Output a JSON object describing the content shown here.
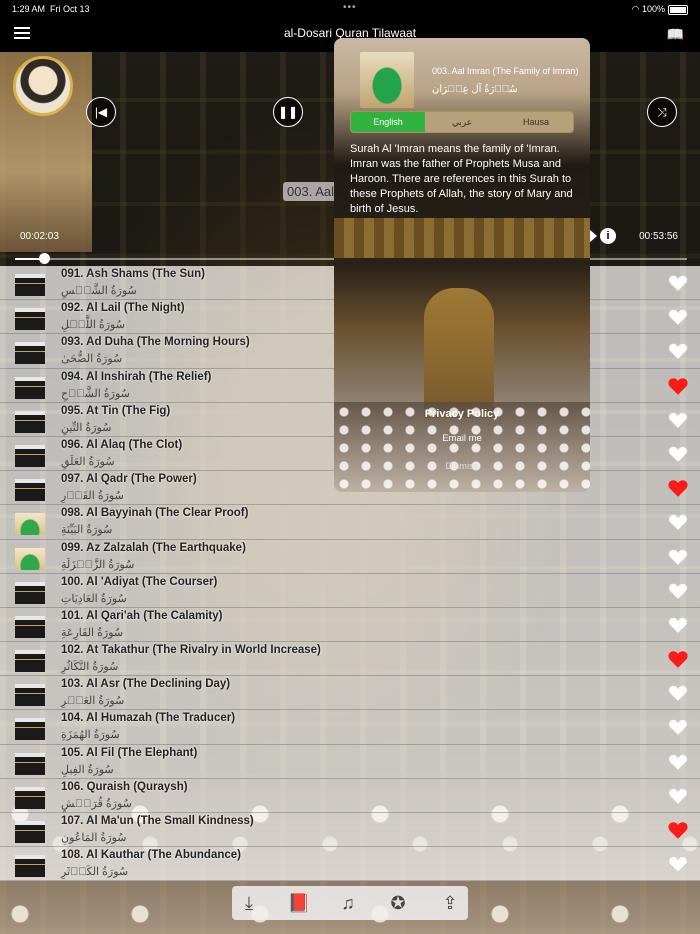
{
  "status": {
    "time": "1:29 AM",
    "date": "Fri Oct 13",
    "dots": "•••",
    "battery": "100%"
  },
  "header": {
    "title": "al-Dosari Quran Tilawaat"
  },
  "player": {
    "track_chip": "003. Aal",
    "elapsed": "00:02:03",
    "duration": "00:53:56",
    "progress": 0.043
  },
  "popup": {
    "title": "003. Aal Imran (The Family of Imran)",
    "arabic": "سُوۡرَةُ آل عِمۡرَان",
    "tabs": [
      {
        "label": "English"
      },
      {
        "label": "عربي"
      },
      {
        "label": "Hausa"
      }
    ],
    "active_tab": 0,
    "description": "Surah Al 'Imran means the family of 'Imran. Imran was the father of Prophets Musa and Haroon. There are references in this Surah to these Prophets of Allah, the story of Mary and birth of Jesus.",
    "privacy": "Privacy Policy",
    "email": "Email me",
    "dismiss": "Dismiss"
  },
  "surahs": [
    {
      "en": "091. Ash Shams (The Sun)",
      "ar": "سُورَةُ الشَّمۡسِ",
      "thumb": "kaaba",
      "fav": false
    },
    {
      "en": "092. Al Lail (The Night)",
      "ar": "سُورَةُ اللَّيۡلِ",
      "thumb": "kaaba",
      "fav": false
    },
    {
      "en": "093. Ad Duha (The Morning Hours)",
      "ar": "سُورَةُ الضُّحَىٰ",
      "thumb": "kaaba",
      "fav": false
    },
    {
      "en": "094. Al Inshirah (The Relief)",
      "ar": "سُورَةُ الشَّرۡحِ",
      "thumb": "kaaba",
      "fav": true
    },
    {
      "en": "095. At Tin (The Fig)",
      "ar": "سُورَةُ التِّينِ",
      "thumb": "kaaba",
      "fav": false
    },
    {
      "en": "096. Al Alaq (The Clot)",
      "ar": "سُورَةُ العَلَقِ",
      "thumb": "kaaba",
      "fav": false
    },
    {
      "en": "097. Al Qadr (The Power)",
      "ar": "سُورَةُ القَدۡرِ",
      "thumb": "kaaba",
      "fav": true
    },
    {
      "en": "098. Al Bayyinah (The Clear Proof)",
      "ar": "سُورَةُ البَيِّنَةِ",
      "thumb": "dome",
      "fav": false
    },
    {
      "en": "099. Az Zalzalah (The Earthquake)",
      "ar": "سُورَةُ الزَّلۡزَلَةِ",
      "thumb": "dome",
      "fav": false
    },
    {
      "en": "100. Al 'Adiyat (The Courser)",
      "ar": "سُورَةُ العَادِيَاتِ",
      "thumb": "kaaba",
      "fav": false
    },
    {
      "en": "101. Al Qari'ah (The Calamity)",
      "ar": "سُورَةُ القَارِعَةِ",
      "thumb": "kaaba",
      "fav": false
    },
    {
      "en": "102. At Takathur (The Rivalry in World Increase)",
      "ar": "سُورَةُ التَّكَاثُرِ",
      "thumb": "kaaba",
      "fav": true
    },
    {
      "en": "103. Al Asr (The Declining Day)",
      "ar": "سُورَةُ العَصۡرِ",
      "thumb": "kaaba",
      "fav": false
    },
    {
      "en": "104. Al Humazah (The Traducer)",
      "ar": "سُورَةُ الهُمَزَةِ",
      "thumb": "kaaba",
      "fav": false
    },
    {
      "en": "105. Al Fil (The Elephant)",
      "ar": "سُورَةُ الفِيلِ",
      "thumb": "kaaba",
      "fav": false
    },
    {
      "en": "106. Quraish (Quraysh)",
      "ar": "سُورَةُ قُرَيۡشٍ",
      "thumb": "kaaba",
      "fav": false
    },
    {
      "en": "107. Al Ma'un (The Small Kindness)",
      "ar": "سُورَةُ المَاعُونِ",
      "thumb": "kaaba",
      "fav": true
    },
    {
      "en": "108. Al Kauthar (The Abundance)",
      "ar": "سُورَةُ الكَوۡثَرِ",
      "thumb": "kaaba",
      "fav": false
    }
  ],
  "colors": {
    "heart_fav": "#ff1a1a",
    "heart_off": "#ffffff",
    "tab_active": "#31b340"
  },
  "toolbar": [
    {
      "icon": "download-icon"
    },
    {
      "icon": "book-icon"
    },
    {
      "icon": "playlist-heart-icon"
    },
    {
      "icon": "star-icon"
    },
    {
      "icon": "share-icon"
    }
  ]
}
